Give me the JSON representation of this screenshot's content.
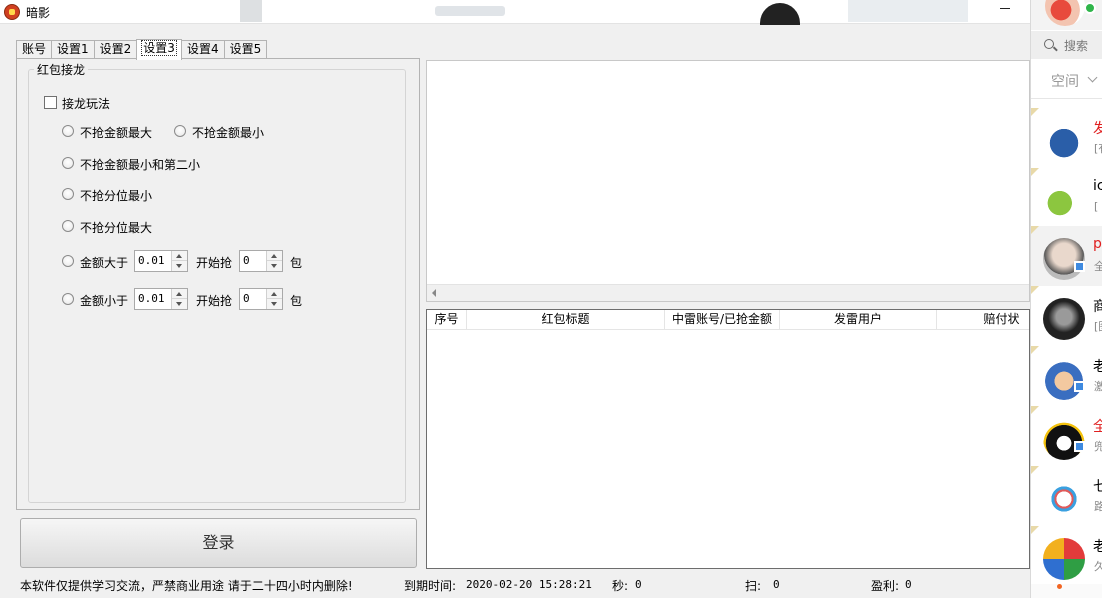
{
  "window": {
    "title": "暗影"
  },
  "tabs": [
    {
      "label": "账号",
      "active": false
    },
    {
      "label": "设置1",
      "active": false
    },
    {
      "label": "设置2",
      "active": false
    },
    {
      "label": "设置3",
      "active": true
    },
    {
      "label": "设置4",
      "active": false
    },
    {
      "label": "设置5",
      "active": false
    }
  ],
  "group": {
    "title": "红包接龙",
    "enable_label": "接龙玩法",
    "enable_checked": false,
    "opt_not_max": "不抢金额最大",
    "opt_not_min": "不抢金额最小",
    "opt_not_min_second": "不抢金额最小和第二小",
    "opt_not_cent_min": "不抢分位最小",
    "opt_not_cent_max": "不抢分位最大",
    "gt": {
      "label": "金额大于",
      "amount": "0.01",
      "start_label": "开始抢",
      "count": "0",
      "unit": "包"
    },
    "lt": {
      "label": "金额小于",
      "amount": "0.01",
      "start_label": "开始抢",
      "count": "0",
      "unit": "包"
    }
  },
  "login_button": "登录",
  "table": {
    "columns": [
      "序号",
      "红包标题",
      "中雷账号/已抢金额",
      "发雷用户",
      "赔付状"
    ],
    "rows": []
  },
  "status": {
    "notice": "本软件仅提供学习交流，严禁商业用途 请于二十四小时内删除!",
    "expire_label": "到期时间:",
    "expire_value": "2020-02-20 15:28:21",
    "sec_label": "秒:",
    "sec_value": "0",
    "scan_label": "扫:",
    "scan_value": "0",
    "profit_label": "盈利:",
    "profit_value": "0"
  },
  "side": {
    "search_placeholder": "搜索",
    "tab_label": "空间",
    "contacts": [
      {
        "name": "发",
        "msg": "[有",
        "name_color": "#e02020"
      },
      {
        "name": "ic",
        "msg": "[",
        "name_color": "#000000"
      },
      {
        "name": "p",
        "msg": "全",
        "name_color": "#e02020"
      },
      {
        "name": "商",
        "msg": "[图",
        "name_color": "#000000"
      },
      {
        "name": "老",
        "msg": "激",
        "name_color": "#000000"
      },
      {
        "name": "全",
        "msg": "兜",
        "name_color": "#e02020"
      },
      {
        "name": "七",
        "msg": "路",
        "name_color": "#000000"
      },
      {
        "name": "老",
        "msg": "久",
        "name_color": "#000000"
      }
    ]
  }
}
